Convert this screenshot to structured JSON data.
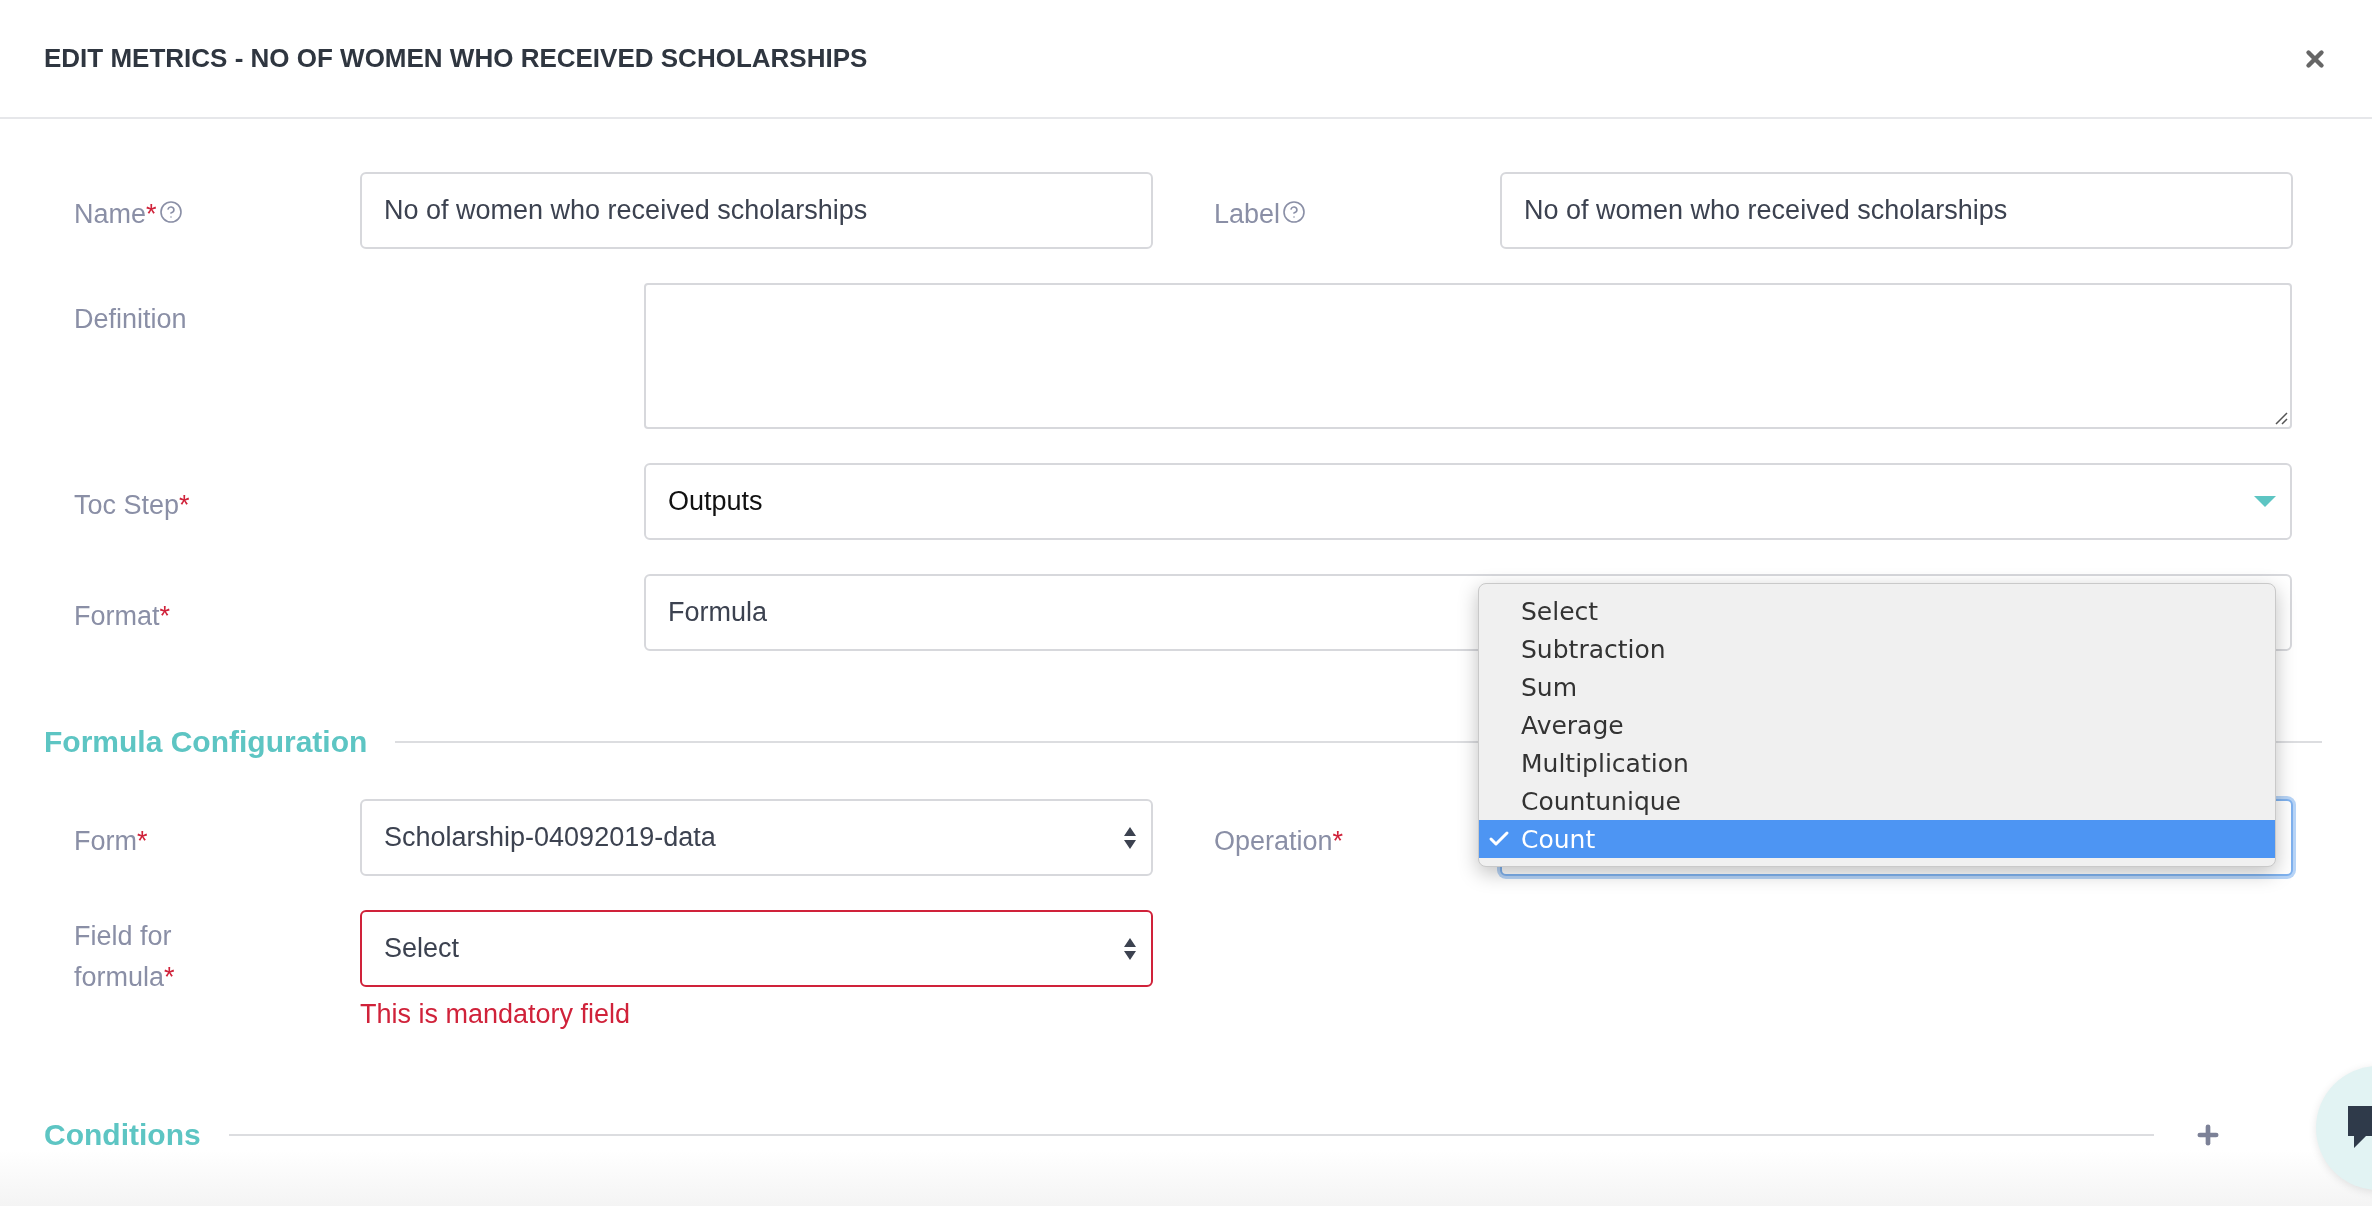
{
  "modal": {
    "title": "EDIT METRICS - NO OF WOMEN WHO RECEIVED SCHOLARSHIPS"
  },
  "rows": [
    {
      "kind": "pair",
      "fields": [
        {
          "label": "Name",
          "required_mark": "*",
          "help": true,
          "kind": "text",
          "value": "No of women who received scholarships"
        },
        {
          "label": "Label",
          "help": true,
          "kind": "text",
          "value": "No of women who received scholarships"
        }
      ]
    },
    {
      "kind": "wide",
      "field": {
        "label": "Definition",
        "kind": "textarea"
      }
    },
    {
      "kind": "wide",
      "field": {
        "label": "Toc Step",
        "required_mark": "*",
        "kind": "dropdown",
        "value": "Outputs"
      }
    },
    {
      "kind": "wide",
      "field": {
        "label": "Format",
        "required_mark": "*",
        "kind": "text",
        "value": "Formula"
      }
    },
    {
      "kind": "section",
      "title": "Formula Configuration"
    },
    {
      "kind": "pair",
      "fields": [
        {
          "label": "Form",
          "required_mark": "*",
          "kind": "select",
          "value": "Scholarship-04092019-data"
        },
        {
          "label": "Operation",
          "required_mark": "*",
          "kind": "select",
          "focused": true,
          "open": true,
          "options": [
            {
              "label": "Select",
              "selected": false
            },
            {
              "label": "Subtraction",
              "selected": false
            },
            {
              "label": "Sum",
              "selected": false
            },
            {
              "label": "Average",
              "selected": false
            },
            {
              "label": "Multiplication",
              "selected": false
            },
            {
              "label": "Countunique",
              "selected": false
            },
            {
              "label": "Count",
              "selected": true
            }
          ]
        }
      ]
    },
    {
      "kind": "pair",
      "fields": [
        {
          "label": "Field for formula",
          "required_mark": "*",
          "kind": "select",
          "value": "Select",
          "invalid": true,
          "error": "This is mandatory field"
        }
      ]
    },
    {
      "kind": "section",
      "title": "Conditions",
      "addable": true
    }
  ]
}
